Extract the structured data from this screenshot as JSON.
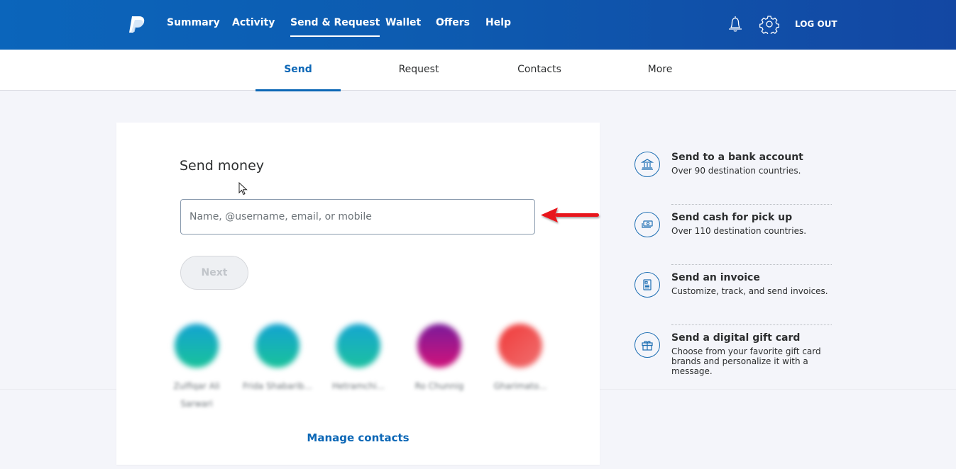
{
  "topnav": {
    "logo": "paypal-logo",
    "items": [
      {
        "label": "Summary",
        "active": false
      },
      {
        "label": "Activity",
        "active": false
      },
      {
        "label": "Send & Request",
        "active": true
      },
      {
        "label": "Wallet",
        "active": false
      },
      {
        "label": "Offers",
        "active": false
      },
      {
        "label": "Help",
        "active": false
      }
    ],
    "icons": [
      "bell-icon",
      "gear-icon"
    ],
    "logout_label": "LOG OUT"
  },
  "subnav": {
    "tabs": [
      {
        "label": "Send",
        "active": true
      },
      {
        "label": "Request",
        "active": false
      },
      {
        "label": "Contacts",
        "active": false
      },
      {
        "label": "More",
        "active": false
      }
    ]
  },
  "send_card": {
    "title": "Send money",
    "recipient_input": {
      "value": "",
      "placeholder": "Name, @username, email, or mobile"
    },
    "next_label": "Next",
    "contacts": [
      {
        "name": "Zulfiqar Ali Sarwari",
        "color_from": "#13a3d1",
        "color_to": "#19c29a"
      },
      {
        "name": "Frida Shabarib...",
        "color_from": "#13a3d1",
        "color_to": "#19c29a"
      },
      {
        "name": "Hetramchi...",
        "color_from": "#15a6d0",
        "color_to": "#1cc0a0"
      },
      {
        "name": "Ro Chunnig",
        "color_from": "#7a1a9a",
        "color_to": "#d1137a"
      },
      {
        "name": "Gharimato...",
        "color_from": "#f03a3a",
        "color_to": "#f07070"
      }
    ],
    "manage_contacts_label": "Manage contacts"
  },
  "side_options": [
    {
      "icon": "bank-icon",
      "title": "Send to a bank account",
      "description": "Over 90 destination countries."
    },
    {
      "icon": "cash-icon",
      "title": "Send cash for pick up",
      "description": "Over 110 destination countries."
    },
    {
      "icon": "invoice-icon",
      "title": "Send an invoice",
      "description": "Customize, track, and send invoices."
    },
    {
      "icon": "gift-icon",
      "title": "Send a digital gift card",
      "description": "Choose from your favorite gift card brands and personalize it with a message."
    }
  ],
  "colors": {
    "header_blue": "#0b65bb",
    "accent_blue": "#0c67b6",
    "annotation_arrow": "#e8161b"
  }
}
